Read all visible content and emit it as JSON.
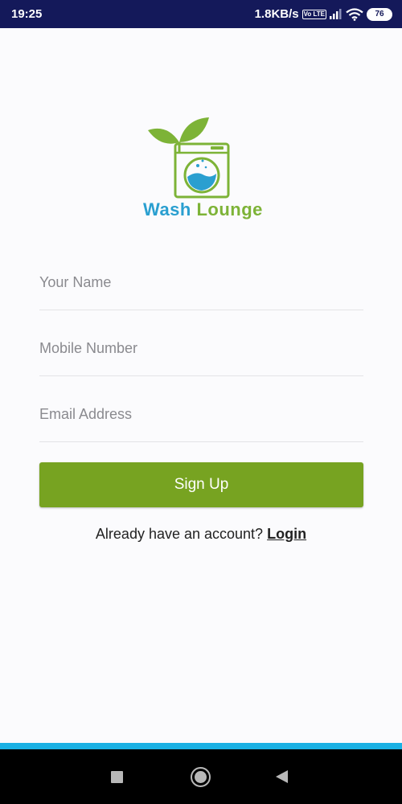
{
  "status_bar": {
    "time": "19:25",
    "network_speed": "1.8KB/s",
    "volte": "Vo LTE",
    "battery": "76"
  },
  "logo": {
    "brand_part1": "Wash",
    "brand_part2": "Lounge"
  },
  "form": {
    "name_placeholder": "Your Name",
    "mobile_placeholder": "Mobile Number",
    "email_placeholder": "Email Address",
    "signup_label": "Sign Up"
  },
  "footer": {
    "prompt": "Already have an account?",
    "login_label": "Login"
  },
  "colors": {
    "status_bar": "#14195a",
    "button": "#77a321",
    "accent_line": "#1ab1e4",
    "brand_blue": "#2a9fd0",
    "brand_green": "#7db337"
  }
}
